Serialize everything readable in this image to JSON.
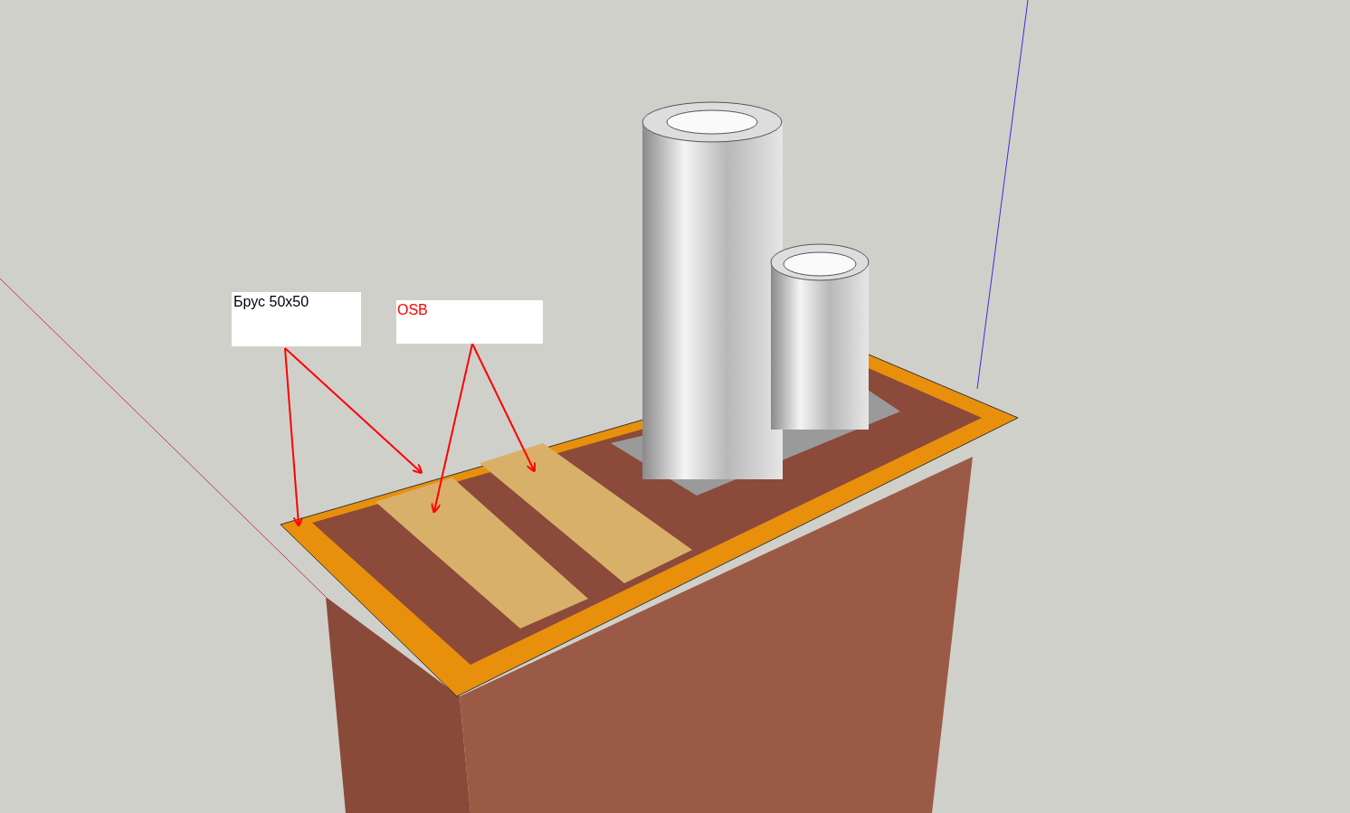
{
  "viewport": {
    "labels": [
      {
        "text": "Брус 50x50",
        "color": "#000000"
      },
      {
        "text": "OSB",
        "color": "#ff0000"
      }
    ]
  }
}
